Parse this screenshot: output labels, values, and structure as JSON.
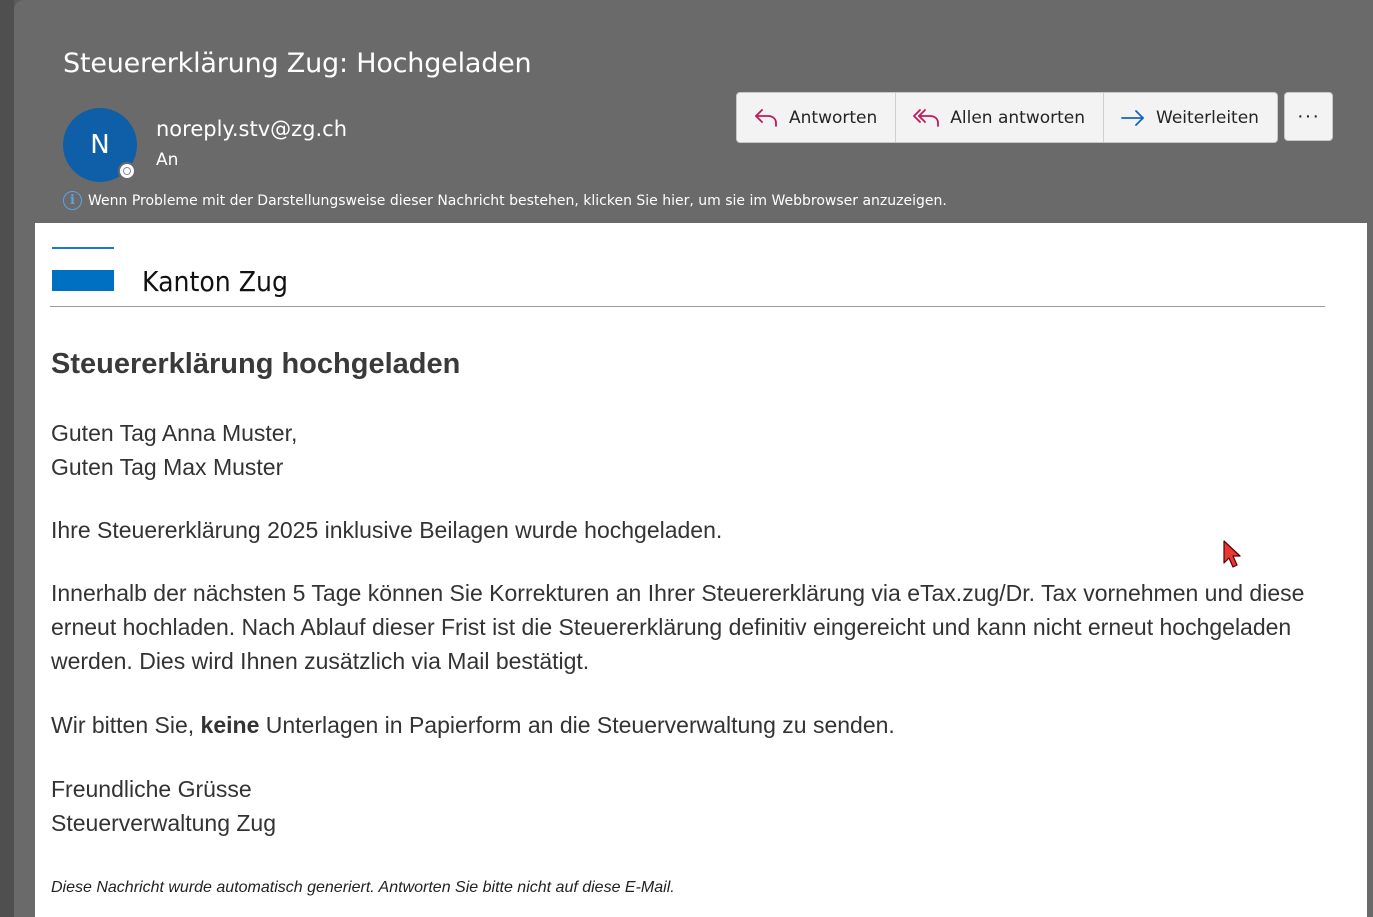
{
  "email": {
    "subject": "Steuererklärung Zug: Hochgeladen",
    "avatar_initial": "N",
    "sender": "noreply.stv@zg.ch",
    "recipient_label": "An",
    "info_message": "Wenn Probleme mit der Darstellungsweise dieser Nachricht bestehen, klicken Sie hier, um sie im Webbrowser anzuzeigen."
  },
  "toolbar": {
    "reply_label": "Antworten",
    "reply_all_label": "Allen antworten",
    "forward_label": "Weiterleiten",
    "more_label": "···"
  },
  "content": {
    "brand": "Kanton Zug",
    "heading": "Steuererklärung hochgeladen",
    "greeting_1": "Guten Tag Anna Muster,",
    "greeting_2": "Guten Tag Max Muster",
    "paragraph_1": "Ihre Steuererklärung 2025 inklusive Beilagen wurde hochgeladen.",
    "paragraph_2": "Innerhalb der nächsten 5 Tage können Sie Korrekturen an Ihrer Steuererklärung via eTax.zug/Dr. Tax vornehmen und diese erneut hochladen. Nach Ablauf dieser Frist ist die Steuererklärung definitiv eingereicht und kann nicht erneut hochgeladen werden. Dies wird Ihnen zusätzlich via Mail bestätigt.",
    "paragraph_3_pre": "Wir bitten Sie, ",
    "paragraph_3_bold": "keine",
    "paragraph_3_post": " Unterlagen in Papierform an die Steuerverwaltung zu senden.",
    "closing_1": "Freundliche Grüsse",
    "closing_2": "Steuerverwaltung Zug",
    "footnote": "Diese Nachricht wurde automatisch generiert. Antworten Sie bitte nicht auf diese E-Mail."
  },
  "colors": {
    "header_bg": "#6a6a6a",
    "avatar": "#0f5ea8",
    "brand_blue": "#0070c0",
    "reply_icon": "#c2185b",
    "forward_icon": "#1565c0",
    "cursor": "#e53935"
  },
  "icons": [
    "reply-icon",
    "reply-all-icon",
    "forward-icon",
    "more-icon",
    "info-icon",
    "cursor-icon"
  ]
}
